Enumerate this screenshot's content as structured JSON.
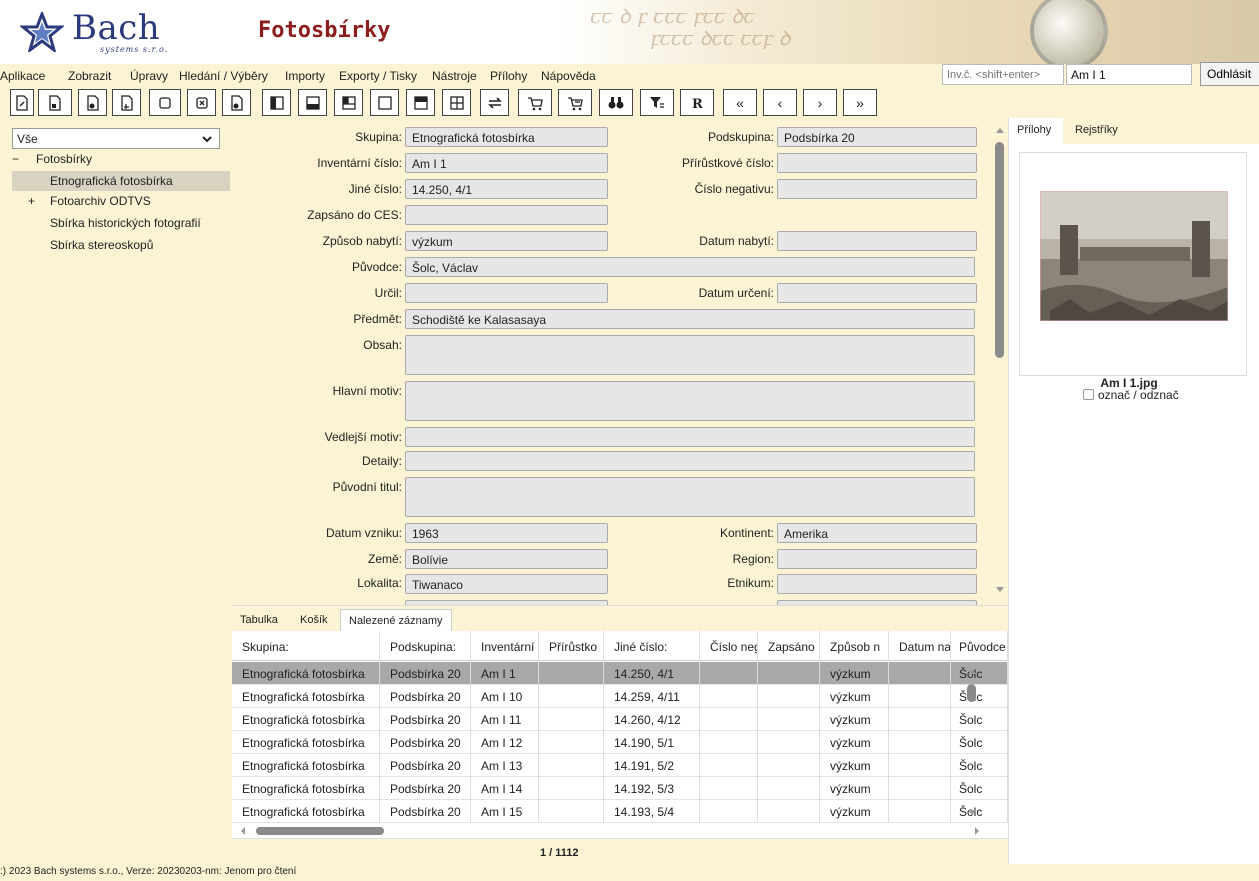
{
  "header": {
    "logo_text": "Bach",
    "logo_sub": "systems s.r.o.",
    "title": "Fotosbírky"
  },
  "menu": [
    "Aplikace",
    "Zobrazit",
    "Úpravy",
    "Hledání / Výběry",
    "Importy",
    "Exporty / Tisky",
    "Nástroje",
    "Přílohy",
    "Nápověda"
  ],
  "search": {
    "invc_placeholder": "Inv.č. <shift+enter>",
    "query": "Am I 1",
    "logout_label": "Odhlásit"
  },
  "toolbar": {
    "icons": [
      "new-record-icon",
      "lock-record-icon",
      "edit-record-icon",
      "copy-record-icon",
      "blank-icon",
      "delete-record-icon",
      "save-record-icon",
      "layout-left-icon",
      "layout-bottom-icon",
      "layout-split-icon",
      "layout-single-icon",
      "layout-top-icon",
      "layout-grid-icon",
      "swap-icon",
      "cart-add-icon",
      "cart-remove-icon",
      "binoculars-icon",
      "filter-icon",
      "report-icon"
    ],
    "nav": [
      "«",
      "‹",
      "›",
      "»"
    ]
  },
  "tree": {
    "filter_value": "Vše",
    "root_toggle": "−",
    "root": "Fotosbírky",
    "items": [
      {
        "label": "Etnografická fotosbírka",
        "toggle": ""
      },
      {
        "label": "Fotoarchiv ODTVS",
        "toggle": "+"
      },
      {
        "label": "Sbírka historických fotografií",
        "toggle": ""
      },
      {
        "label": "Sbírka stereoskopů",
        "toggle": ""
      }
    ]
  },
  "form": {
    "skupina_label": "Skupina:",
    "skupina": "Etnografická fotosbírka",
    "podskupina_label": "Podskupina:",
    "podskupina": "Podsbírka 20",
    "inv_cislo_label": "Inventární číslo:",
    "inv_cislo": "Am I 1",
    "prirustkove_label": "Přírůstkové číslo:",
    "prirustkove": "",
    "jine_cislo_label": "Jiné číslo:",
    "jine_cislo": "14.250, 4/1",
    "cislo_negativu_label": "Číslo negativu:",
    "cislo_negativu": "",
    "zapsano_ces_label": "Zapsáno do CES:",
    "zapsano_ces": "",
    "zpusob_nabyti_label": "Způsob nabytí:",
    "zpusob_nabyti": "výzkum",
    "datum_nabyti_label": "Datum nabytí:",
    "datum_nabyti": "",
    "puvodce_label": "Původce:",
    "puvodce": "Šolc, Václav",
    "urcil_label": "Určil:",
    "urcil": "",
    "datum_urceni_label": "Datum určení:",
    "datum_urceni": "",
    "predmet_label": "Předmět:",
    "predmet": "Schodiště ke Kalasasaya",
    "obsah_label": "Obsah:",
    "obsah": "",
    "hlavni_motiv_label": "Hlavní motiv:",
    "hlavni_motiv": "",
    "vedlejsi_motiv_label": "Vedlejší motiv:",
    "vedlejsi_motiv": "",
    "detaily_label": "Detaily:",
    "detaily": "",
    "puvodni_titul_label": "Původní titul:",
    "puvodni_titul": "",
    "datum_vzniku_label": "Datum vzniku:",
    "datum_vzniku": "1963",
    "kontinent_label": "Kontinent:",
    "kontinent": "Amerika",
    "zeme_label": "Země:",
    "zeme": "Bolívie",
    "region_label": "Region:",
    "region": "",
    "lokalita_label": "Lokalita:",
    "lokalita": "Tiwanaco",
    "etnikum_label": "Etnikum:",
    "etnikum": ""
  },
  "right": {
    "tab_prilohy": "Přílohy",
    "tab_rejstriky": "Rejstříky",
    "filename": "Am I 1.jpg",
    "mark_label": "označ / odznač"
  },
  "bottom_tabs": [
    "Tabulka",
    "Košík",
    "Nalezené záznamy"
  ],
  "grid": {
    "columns": [
      "Skupina:",
      "Podskupina:",
      "Inventární",
      "Přírůstko",
      "Jiné číslo:",
      "Číslo neg",
      "Zapsáno",
      "Způsob n",
      "Datum na",
      "Původce"
    ],
    "rows": [
      [
        "Etnografická fotosbírka",
        "Podsbírka 20",
        "Am I 1",
        "",
        "14.250, 4/1",
        "",
        "",
        "výzkum",
        "",
        "Šolc"
      ],
      [
        "Etnografická fotosbírka",
        "Podsbírka 20",
        "Am I 10",
        "",
        "14.259, 4/11",
        "",
        "",
        "výzkum",
        "",
        "Šolc"
      ],
      [
        "Etnografická fotosbírka",
        "Podsbírka 20",
        "Am I 11",
        "",
        "14.260, 4/12",
        "",
        "",
        "výzkum",
        "",
        "Šolc"
      ],
      [
        "Etnografická fotosbírka",
        "Podsbírka 20",
        "Am I 12",
        "",
        "14.190, 5/1",
        "",
        "",
        "výzkum",
        "",
        "Šolc"
      ],
      [
        "Etnografická fotosbírka",
        "Podsbírka 20",
        "Am I 13",
        "",
        "14.191, 5/2",
        "",
        "",
        "výzkum",
        "",
        "Šolc"
      ],
      [
        "Etnografická fotosbírka",
        "Podsbírka 20",
        "Am I 14",
        "",
        "14.192, 5/3",
        "",
        "",
        "výzkum",
        "",
        "Šolc"
      ],
      [
        "Etnografická fotosbírka",
        "Podsbírka 20",
        "Am I 15",
        "",
        "14.193, 5/4",
        "",
        "",
        "výzkum",
        "",
        "Šolc"
      ]
    ],
    "selected_row": 0,
    "pager": "1 / 1112"
  },
  "status": ":) 2023 Bach systems s.r.o., Verze: 20230203-nm: Jenom pro čtení"
}
